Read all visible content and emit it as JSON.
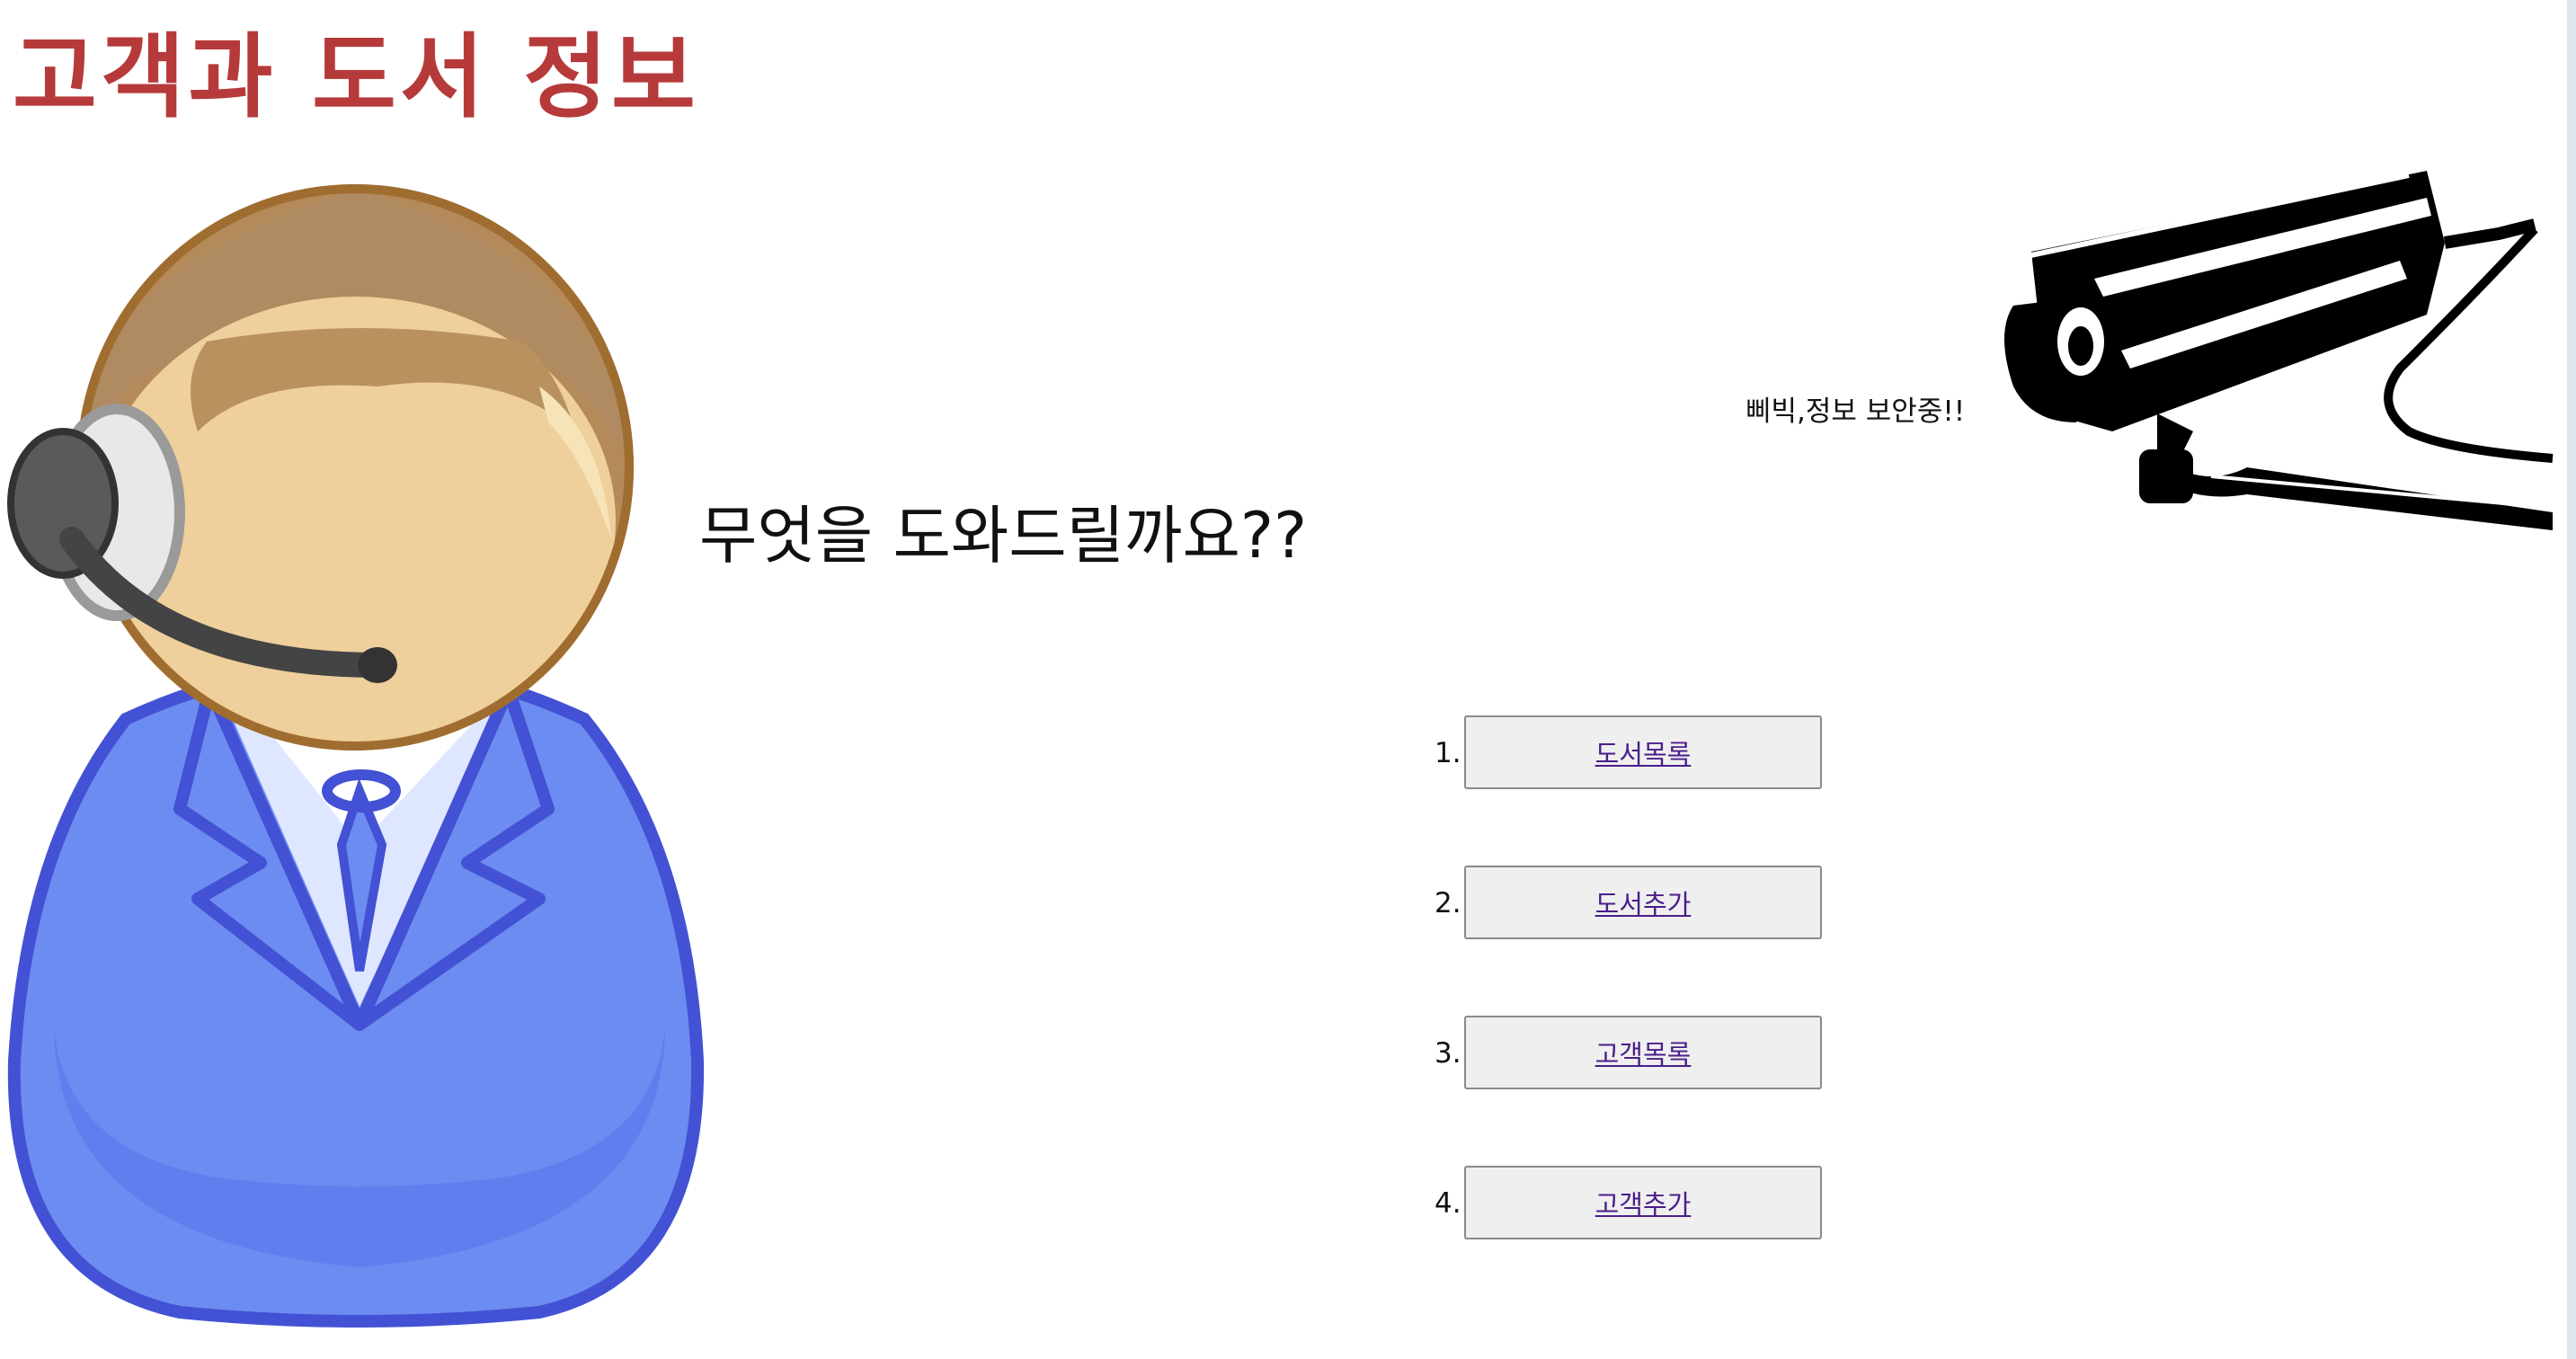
{
  "header": {
    "title": "고객과 도서 정보"
  },
  "main": {
    "question": "무엇을 도와드릴까요??",
    "security_caption": "삐빅,정보 보안중!!",
    "menu": [
      {
        "number": "1.",
        "label": "도서목록"
      },
      {
        "number": "2.",
        "label": "도서추가"
      },
      {
        "number": "3.",
        "label": "고객목록"
      },
      {
        "number": "4.",
        "label": "고객추가"
      }
    ]
  },
  "icons": {
    "agent": "customer-service-agent-icon",
    "camera": "security-camera-icon"
  },
  "colors": {
    "title": "#b63a3a",
    "link": "#4a1d8a",
    "button_bg": "#efefef",
    "agent_body": "#6f8ef2",
    "agent_face": "#f0cf9a"
  }
}
